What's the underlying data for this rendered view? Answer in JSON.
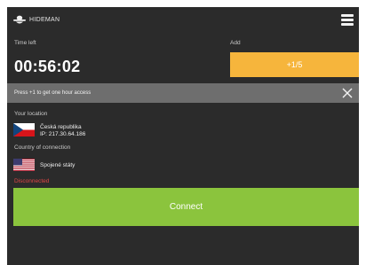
{
  "header": {
    "brand": "HIDEMAN",
    "menu_icon": "hamburger-menu-icon"
  },
  "timer": {
    "label": "Time left",
    "value": "00:56:02"
  },
  "add": {
    "label": "Add",
    "button_label": "+1/5"
  },
  "notice": {
    "text": "Press +1 to get one hour access",
    "close_icon": "close-icon"
  },
  "location": {
    "label": "Your location",
    "country": "Česká republika",
    "ip": "IP: 217.30.64.186"
  },
  "connection": {
    "label": "Country of connection",
    "country": "Spojené státy"
  },
  "status": {
    "text": "Disconnected",
    "color": "#e04545"
  },
  "connect_button": {
    "label": "Connect",
    "color": "#8bc43d"
  },
  "colors": {
    "background": "#2b2b2b",
    "add_button": "#f6b53c",
    "notice_bar": "#6e6e6e"
  }
}
